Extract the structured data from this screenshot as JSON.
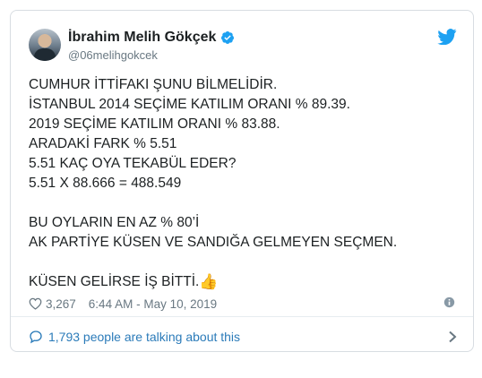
{
  "tweet": {
    "author": {
      "name": "İbrahim Melih Gökçek",
      "handle": "@06melihgokcek"
    },
    "lines": [
      "CUMHUR İTTİFAKI ŞUNU BİLMELİDİR.",
      "İSTANBUL 2014 SEÇİME KATILIM ORANI % 89.39.",
      "2019 SEÇİME KATILIM ORANI % 83.88.",
      "ARADAKİ FARK % 5.51",
      "5.51 KAÇ OYA TEKABÜL EDER?",
      "5.51 X 88.666 = 488.549",
      "",
      "BU OYLARIN EN AZ % 80’İ",
      "AK PARTİYE KÜSEN VE SANDIĞA GELMEYEN SEÇMEN.",
      "",
      "KÜSEN GELİRSE İŞ BİTTİ."
    ],
    "emoji": "👍",
    "likes": "3,267",
    "timestamp": "6:44 AM - May 10, 2019",
    "conversation": "1,793 people are talking about this"
  },
  "colors": {
    "brand": "#1da1f2",
    "link": "#2b7bb9",
    "muted": "#697882"
  },
  "icons": [
    "twitter-bird-icon",
    "verified-badge-icon",
    "heart-icon",
    "info-icon",
    "comment-bubble-icon",
    "chevron-right-icon"
  ]
}
